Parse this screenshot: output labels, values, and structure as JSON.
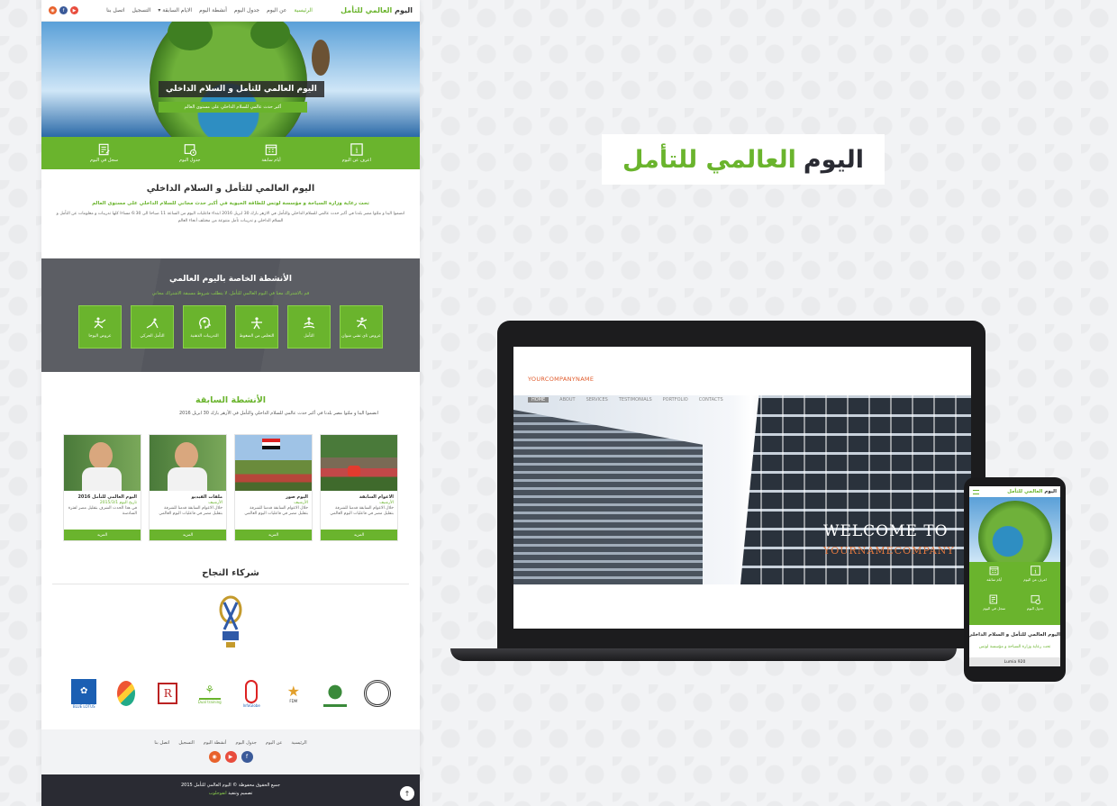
{
  "site": {
    "brand_prefix": "اليوم ",
    "brand_accent": "العالمي للتأمل",
    "nav": [
      "الرئيسية",
      "عن اليوم",
      "جدول اليوم",
      "أنشطة اليوم",
      "الايام السابقة ▾",
      "التسجيل",
      "اتصل بنا"
    ],
    "hero": {
      "title": "اليوم العالمي للتأمل و السلام الداخلي",
      "subtitle": "أكبر حدث عالمي للسلام الداخلي على مستوى العالم"
    },
    "features": [
      "اعرف عن اليوم",
      "أيام سابقة",
      "جدول اليوم",
      "سجل في اليوم"
    ],
    "intro": {
      "title": "اليوم العالمي للتأمل و السلام الداخلي",
      "green": "تحت رعاية وزارة السياحة و مؤسسة لوتس للطاقة الحيوية في أكبر حدث مجاني للسلام الداخلي على مستوى العالم",
      "paragraph": "انضموا الينا و ملئوا مصر بلدنا في أكبر حدث عالمي للسلام الداخلي والتأمل في الازهر بارك 30 ابريل 2016 ابتداء فاعليات اليوم من الساعة 11 صباحا الى 6:30 مساءا كلها تدريبات و معلومات عن التأمل و السلام الداخلي و تدريبات تأمل متنوعة من مختلف أنحاء العالم"
    },
    "activities": {
      "title": "الأنشطة الخاصة باليوم العالمي",
      "subtitle": "قم بالاشتراك معنا في اليوم العالمي للتأمل. لا يتطلب شروط مسبقة الاشتراك مجاني",
      "items": [
        "عروض تاي تشي شوان",
        "التأمل",
        "التخلص من الضغوط",
        "التدريبات الذهنية",
        "التأمل الحركي",
        "عروض اليوجا"
      ]
    },
    "past": {
      "title": "الأنشطة السابقة",
      "description": "انضموا الينا و ملئوا مصر بلدنا في أكبر حدث عالمي للسلام الداخلي والتأمل في الأزهر بارك 30 ابريل 2016",
      "cards": [
        {
          "title": "الاعوام السابقة",
          "meta": "الأرشيف",
          "text": "خلال الاعوام السابقة قدمنا للشرفة بتقليل مصر في فاعليات اليوم العالمي",
          "button": "المزيد"
        },
        {
          "title": "اليوم صور",
          "meta": "الأرشيف",
          "text": "خلال الاعوام السابقة قدمنا للشرفة بتقليل مصر في فاعليات اليوم العالمي",
          "button": "المزيد"
        },
        {
          "title": "ملفات الفيديو",
          "meta": "الأرشيف",
          "text": "خلال الاعوام السابقة قدمنا للشرفة بتقليل مصر في فاعليات اليوم العالمي",
          "button": "المزيد"
        },
        {
          "title": "اليوم العالمي للتأمل 2016",
          "meta": "تاريخ اليوم 2015/3/1",
          "text": "في هذا الحدث الشرف بتقليل مصر لفترة السادسة",
          "button": "المزيد"
        }
      ]
    },
    "partners": {
      "title": "شركاء النجاح",
      "logos": [
        "BLUE LOTUS",
        "",
        "",
        "Dual training",
        "InfoGlobe",
        "FDM",
        "",
        ""
      ]
    },
    "footer": {
      "links": [
        "الرئيسية",
        "عن اليوم",
        "جدول اليوم",
        "أنشطة اليوم",
        "التسجيل",
        "اتصل بنا"
      ],
      "copyright": "جميع الحقوق محفوظة © اليوم العالمي للتأمل 2015",
      "design_prefix": "تصميم وتنفيذ ",
      "design_by": "انفوجلوب"
    }
  },
  "showcase": {
    "brand_dark": "اليوم",
    "brand_green": "العالمي للتأمل"
  },
  "laptop": {
    "company": "YOURCOMPANYNAME",
    "nav": [
      "HOME",
      "ABOUT",
      "SERVICES",
      "TESTIMONIALS",
      "PORTFOLIO",
      "CONTACTS"
    ],
    "welcome": "WELCOME TO",
    "name": "YOURNAMECOMPANY"
  },
  "phone": {
    "brand_prefix": "اليوم ",
    "brand_accent": "العالمي للتأمل",
    "features": [
      "اعرف عن اليوم",
      "أيام سابقة",
      "جدول اليوم",
      "سجل في اليوم"
    ],
    "title": "اليوم العالمي للتأمل و السلام الداخلي",
    "subtitle": "تحت رعاية وزارة السياحة و مؤسسة لوتس",
    "bottom": "Lumia 920"
  },
  "colors": {
    "accent": "#6ab42d",
    "dark": "#2a2b33",
    "gray_band": "#55575e"
  }
}
